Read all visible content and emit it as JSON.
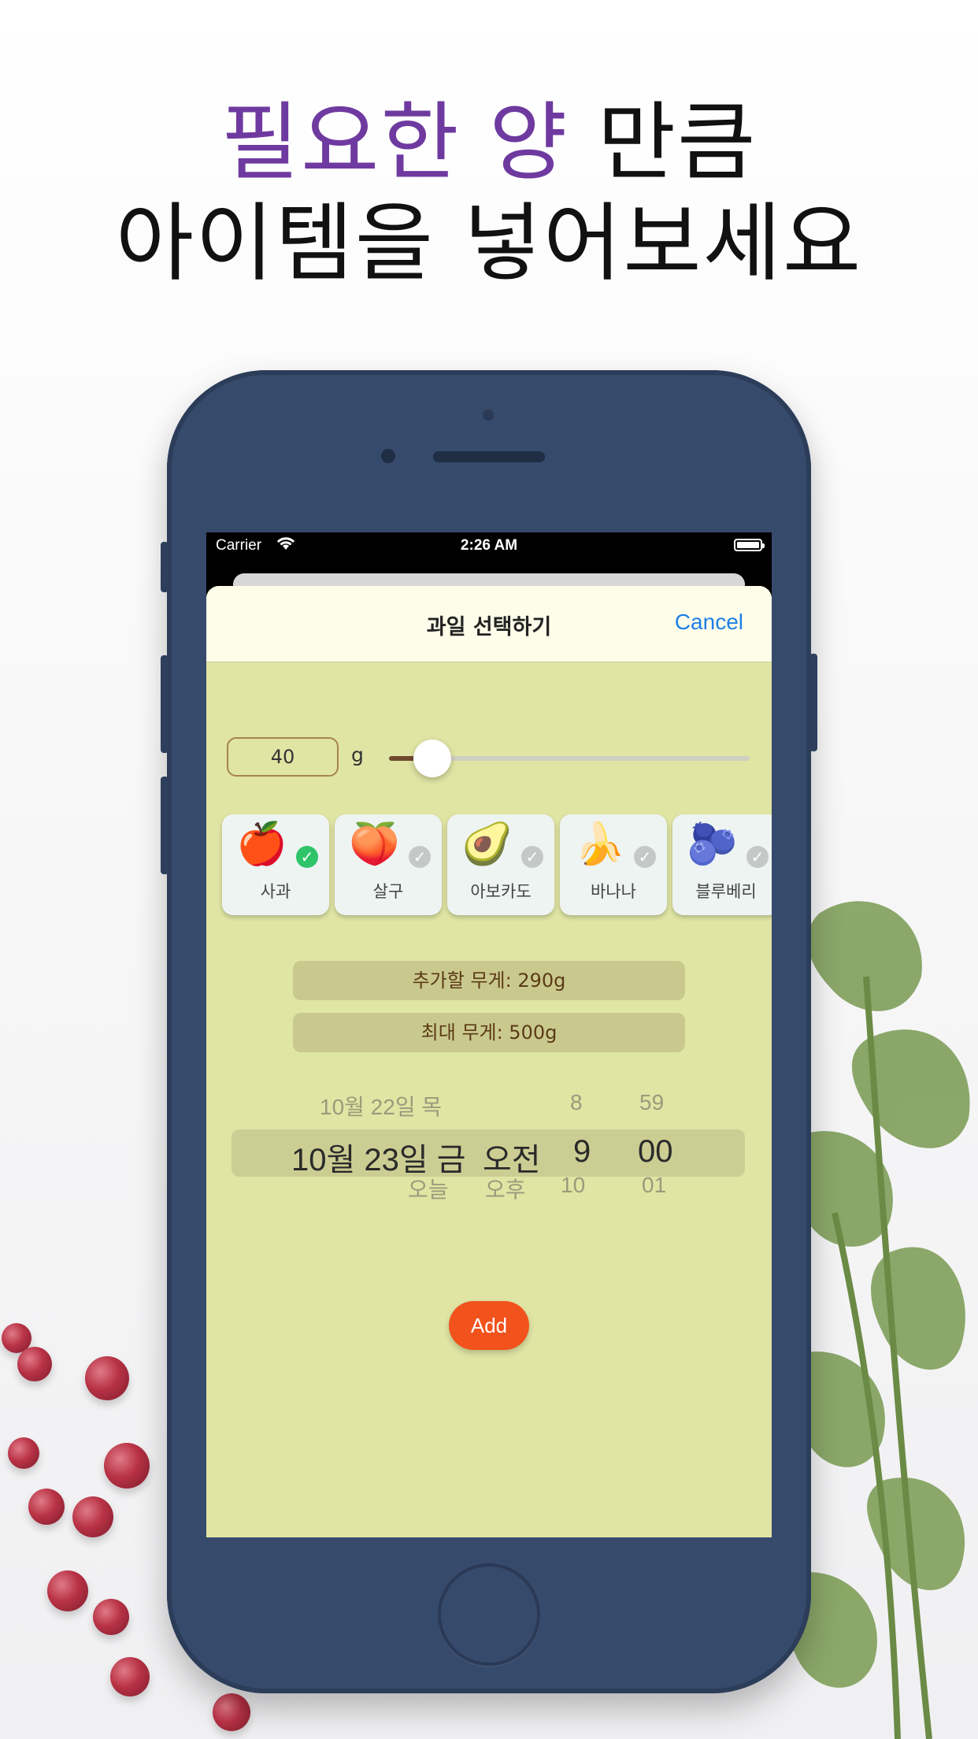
{
  "headline": {
    "line1_accent": "필요한 양",
    "line1_rest": " 만큼",
    "line2": "아이템을 넣어보세요"
  },
  "colors": {
    "accent": "#6f3aa0",
    "sheet": "#e0e5a4",
    "add": "#f2521c",
    "cancel": "#1e7fe6",
    "phone": "#364a6b"
  },
  "status_bar": {
    "carrier": "Carrier",
    "wifi_icon": "wifi-icon",
    "time": "2:26 AM",
    "battery_icon": "battery-icon"
  },
  "nav": {
    "title": "과일 선택하기",
    "cancel": "Cancel"
  },
  "weight": {
    "value": "40",
    "unit": "g",
    "slider_fraction": 0.12
  },
  "fruits": [
    {
      "emoji": "🍎",
      "name": "사과",
      "selected": true
    },
    {
      "emoji": "🍑",
      "name": "살구",
      "selected": false
    },
    {
      "emoji": "🥑",
      "name": "아보카도",
      "selected": false
    },
    {
      "emoji": "🍌",
      "name": "바나나",
      "selected": false
    },
    {
      "emoji": "🫐",
      "name": "블루베리",
      "selected": false
    }
  ],
  "info": {
    "to_add": "추가할 무게: 290g",
    "max": "최대 무게: 500g"
  },
  "date_picker": {
    "prev": {
      "date": "10월 22일 목",
      "hour": "8",
      "minute": "59"
    },
    "selected": {
      "date": "10월 23일 금",
      "ampm": "오전",
      "hour": "9",
      "minute": "00"
    },
    "next": {
      "date": "오늘",
      "ampm": "오후",
      "hour": "10",
      "minute": "01"
    }
  },
  "add_button": "Add"
}
